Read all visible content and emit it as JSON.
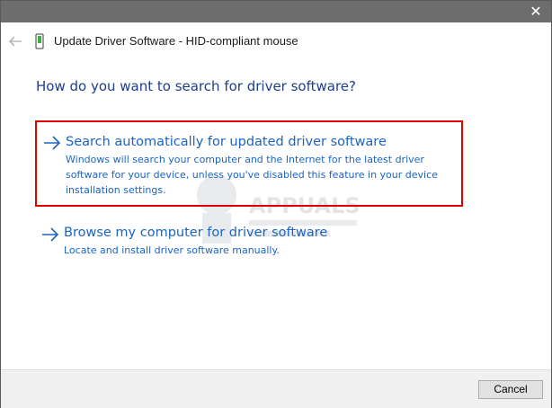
{
  "window": {
    "nav_title": "Update Driver Software - HID-compliant mouse",
    "close_glyph": "✕"
  },
  "heading": "How do you want to search for driver software?",
  "options": [
    {
      "title": "Search automatically for updated driver software",
      "description": "Windows will search your computer and the Internet for the latest driver software for your device, unless you've disabled this feature in your device installation settings.",
      "highlighted": true,
      "icon": "arrow-right-icon"
    },
    {
      "title": "Browse my computer for driver software",
      "description": "Locate and install driver software manually.",
      "highlighted": false,
      "icon": "arrow-right-icon"
    }
  ],
  "footer": {
    "cancel_label": "Cancel"
  },
  "watermark": {
    "text": "APPUALS"
  },
  "colors": {
    "titlebar": "#6d6d6d",
    "link_blue": "#1b63c5",
    "heading_blue": "#1f3d8f",
    "highlight_red": "#e00000",
    "footer_bg": "#f0f0f0"
  }
}
